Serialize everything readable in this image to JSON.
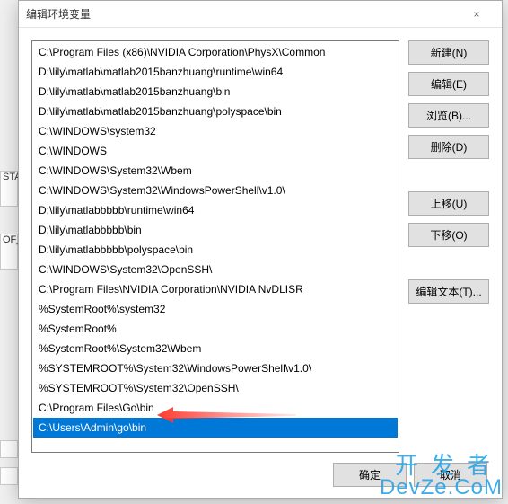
{
  "dialog": {
    "title": "编辑环境变量",
    "close_icon": "×"
  },
  "background": {
    "frag1": "STA",
    "frag2": "OF_P"
  },
  "list": {
    "items": [
      "C:\\Program Files (x86)\\NVIDIA Corporation\\PhysX\\Common",
      "D:\\lily\\matlab\\matlab2015banzhuang\\runtime\\win64",
      "D:\\lily\\matlab\\matlab2015banzhuang\\bin",
      "D:\\lily\\matlab\\matlab2015banzhuang\\polyspace\\bin",
      "C:\\WINDOWS\\system32",
      "C:\\WINDOWS",
      "C:\\WINDOWS\\System32\\Wbem",
      "C:\\WINDOWS\\System32\\WindowsPowerShell\\v1.0\\",
      "D:\\lily\\matlabbbbb\\runtime\\win64",
      "D:\\lily\\matlabbbbb\\bin",
      "D:\\lily\\matlabbbbb\\polyspace\\bin",
      "C:\\WINDOWS\\System32\\OpenSSH\\",
      "C:\\Program Files\\NVIDIA Corporation\\NVIDIA NvDLISR",
      "%SystemRoot%\\system32",
      "%SystemRoot%",
      "%SystemRoot%\\System32\\Wbem",
      "%SYSTEMROOT%\\System32\\WindowsPowerShell\\v1.0\\",
      "%SYSTEMROOT%\\System32\\OpenSSH\\",
      "C:\\Program Files\\Go\\bin",
      "C:\\Users\\Admin\\go\\bin"
    ],
    "selected_index": 19
  },
  "buttons": {
    "new": "新建(N)",
    "edit": "编辑(E)",
    "browse": "浏览(B)...",
    "delete": "删除(D)",
    "moveup": "上移(U)",
    "movedown": "下移(O)",
    "edittext": "编辑文本(T)...",
    "ok": "确定",
    "cancel": "取消"
  },
  "watermark": {
    "line1": "开发者",
    "line2": "DevZe.CoM"
  }
}
